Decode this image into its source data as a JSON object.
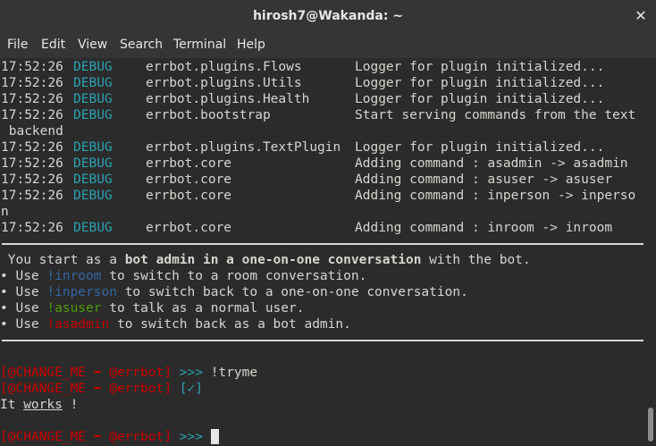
{
  "window": {
    "title": "hirosh7@Wakanda: ~",
    "close": "✕"
  },
  "menu": [
    "File",
    "Edit",
    "View",
    "Search",
    "Terminal",
    "Help"
  ],
  "log": [
    {
      "time": "17:52:26",
      "level": "DEBUG",
      "module": "errbot.plugins.Flows",
      "msg": "Logger for plugin initialized..."
    },
    {
      "time": "17:52:26",
      "level": "DEBUG",
      "module": "errbot.plugins.Utils",
      "msg": "Logger for plugin initialized..."
    },
    {
      "time": "17:52:26",
      "level": "DEBUG",
      "module": "errbot.plugins.Health",
      "msg": "Logger for plugin initialized..."
    },
    {
      "time": "17:52:26",
      "level": "DEBUG",
      "module": "errbot.bootstrap",
      "msg": "Start serving commands from the text"
    },
    {
      "wrap": " backend"
    },
    {
      "time": "17:52:26",
      "level": "DEBUG",
      "module": "errbot.plugins.TextPlugin",
      "msg": "Logger for plugin initialized..."
    },
    {
      "time": "17:52:26",
      "level": "DEBUG",
      "module": "errbot.core",
      "msg": "Adding command : asadmin -> asadmin"
    },
    {
      "time": "17:52:26",
      "level": "DEBUG",
      "module": "errbot.core",
      "msg": "Adding command : asuser -> asuser"
    },
    {
      "time": "17:52:26",
      "level": "DEBUG",
      "module": "errbot.core",
      "msg": "Adding command : inperson -> inperso"
    },
    {
      "wrap": "n"
    },
    {
      "time": "17:52:26",
      "level": "DEBUG",
      "module": "errbot.core",
      "msg": "Adding command : inroom -> inroom"
    }
  ],
  "intro": {
    "pre": " You start as a ",
    "bold": "bot admin in a one-on-one conversation",
    "post": " with the bot."
  },
  "tips": [
    {
      "bullet": "•",
      "pre": " Use ",
      "cmd": "!inroom",
      "post": " to switch to a room conversation.",
      "color": "blue"
    },
    {
      "bullet": "•",
      "pre": " Use ",
      "cmd": "!inperson",
      "post": " to switch back to a one-on-one conversation.",
      "color": "blue"
    },
    {
      "bullet": "•",
      "pre": " Use ",
      "cmd": "!asuser",
      "post": " to talk as a normal user.",
      "color": "green"
    },
    {
      "bullet": "•",
      "pre": " Use ",
      "cmd": "!asadmin",
      "post": " to switch back as a bot admin.",
      "color": "red"
    }
  ],
  "session": {
    "prompt": "[@CHANGE_ME ➡ @errbot]",
    "arrows": ">>>",
    "command": "!tryme",
    "ack": "[✓]",
    "reply_pre": "It ",
    "reply_u": "works",
    "reply_post": " !"
  },
  "colors": {
    "debug": "#2aa1b3",
    "prompt": "#cc0000",
    "text": "#d3d7cf",
    "blue": "#3465a4",
    "green": "#4e9a06",
    "red": "#cc0000"
  }
}
